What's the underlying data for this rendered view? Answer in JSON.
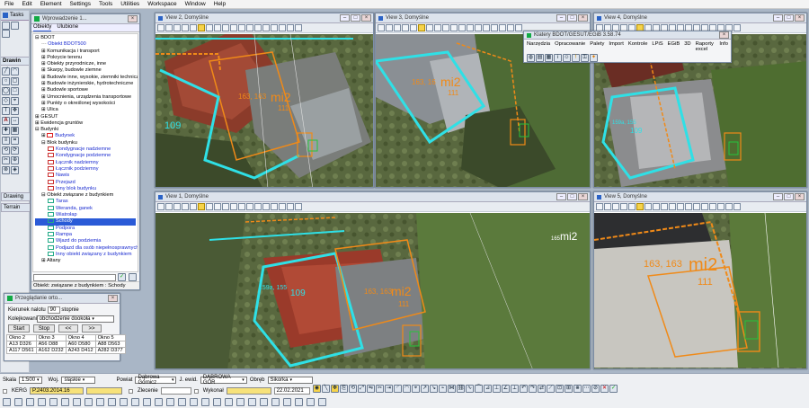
{
  "menu": [
    "File",
    "Edit",
    "Element",
    "Settings",
    "Tools",
    "Utilities",
    "Workspace",
    "Window",
    "Help"
  ],
  "left_panels": {
    "tasks": "Tasks",
    "drawing": "Drawin",
    "drawing2": "Drawing",
    "terrain": "Terrain"
  },
  "objects_window": {
    "title": "Wprowadzenie 1...",
    "tabs": [
      "Obiekty",
      "Ulubione"
    ],
    "tree": [
      {
        "label": "BDOT",
        "level": 0,
        "toggle": "⊟",
        "blue": false
      },
      {
        "label": "Obiekt BDOT500",
        "level": 1,
        "toggle": "",
        "blue": true,
        "dash": true
      },
      {
        "label": "Komunikacja i transport",
        "level": 1,
        "toggle": "⊞"
      },
      {
        "label": "Pokrycie terenu",
        "level": 1,
        "toggle": "⊞"
      },
      {
        "label": "Obiekty przyrodnicze, inne",
        "level": 1,
        "toggle": "⊞"
      },
      {
        "label": "Skarpy, budowle ziemne",
        "level": 1,
        "toggle": "⊞"
      },
      {
        "label": "Budowle inne, wysokie, ziemniki technicz",
        "level": 1,
        "toggle": "⊞"
      },
      {
        "label": "Budowle inżynierskie, hydrotechniczne",
        "level": 1,
        "toggle": "⊞"
      },
      {
        "label": "Budowle sportowe",
        "level": 1,
        "toggle": "⊞"
      },
      {
        "label": "Umocnienia, urządzenia transportowe",
        "level": 1,
        "toggle": "⊞"
      },
      {
        "label": "Punkty o określonej wysokości",
        "level": 1,
        "toggle": "⊞"
      },
      {
        "label": "Ulica",
        "level": 1,
        "toggle": "⊞"
      },
      {
        "label": "GESUT",
        "level": 0,
        "toggle": "⊞"
      },
      {
        "label": "Ewidencja gruntów",
        "level": 0,
        "toggle": "⊞"
      },
      {
        "label": "Budynki",
        "level": 0,
        "toggle": "⊟"
      },
      {
        "label": "Budynek",
        "level": 1,
        "toggle": "⊞",
        "blue": true,
        "swatch": "#d22"
      },
      {
        "label": "Blok budynku",
        "level": 1,
        "toggle": "⊟"
      },
      {
        "label": "Kondygnacje nadziemne",
        "level": 2,
        "blue": true,
        "swatch": "#c33"
      },
      {
        "label": "Kondygnacje podziemne",
        "level": 2,
        "blue": true,
        "swatch": "#c33"
      },
      {
        "label": "Łącznik nadziemny",
        "level": 2,
        "blue": true,
        "swatch": "#c33"
      },
      {
        "label": "Łącznik podziemny",
        "level": 2,
        "blue": true,
        "swatch": "#c33"
      },
      {
        "label": "Nawis",
        "level": 2,
        "blue": true,
        "swatch": "#c33"
      },
      {
        "label": "Przejazd",
        "level": 2,
        "blue": true,
        "swatch": "#c33"
      },
      {
        "label": "Inny blok budynku",
        "level": 2,
        "blue": true,
        "swatch": "#c33"
      },
      {
        "label": "Obiekt związane z budynkiem",
        "level": 1,
        "toggle": "⊟"
      },
      {
        "label": "Taras",
        "level": 2,
        "blue": true,
        "swatch": "#2a8"
      },
      {
        "label": "Weranda, ganek",
        "level": 2,
        "blue": true,
        "swatch": "#2a8"
      },
      {
        "label": "Wiatrołap",
        "level": 2,
        "blue": true,
        "swatch": "#2a8"
      },
      {
        "label": "Schody",
        "level": 2,
        "blue": true,
        "selected": true,
        "swatch": "#2a8"
      },
      {
        "label": "Podpora",
        "level": 2,
        "blue": true,
        "swatch": "#2a8"
      },
      {
        "label": "Rampa",
        "level": 2,
        "blue": true,
        "swatch": "#2a8"
      },
      {
        "label": "Wjazd do podziemia",
        "level": 2,
        "blue": true,
        "swatch": "#2a8"
      },
      {
        "label": "Podjazd dla osób niepełnosprawnych",
        "level": 2,
        "blue": true,
        "swatch": "#2a8"
      },
      {
        "label": "Inny obiekt związany z budynkiem",
        "level": 2,
        "blue": true,
        "swatch": "#2a8"
      },
      {
        "label": "Altany",
        "level": 1,
        "toggle": "⊞"
      }
    ],
    "status": "Obiekt: związane z budynkiem : Schody"
  },
  "browse_window": {
    "title": "Przeglądanie orto...",
    "kierunek_label": "Kierunek nalotu",
    "kierunek_value": "90",
    "kierunek_unit": "stopnie",
    "kolejkowanie_label": "Kolejkowanie",
    "kolejkowanie_value": "obchodzenie dookoła",
    "start": "Start",
    "stop": "Stop",
    "prev": "<<",
    "next": ">>",
    "columns": [
      "Okno 2",
      "Okno 3",
      "Okno 4",
      "Okno 5"
    ],
    "rows": [
      [
        "A13 D326",
        "A56 D88",
        "A60 D580",
        "A88 D563"
      ],
      [
        "A117 D561",
        "A162 D232",
        "A243 D412",
        "A282 D377"
      ]
    ]
  },
  "bdot_toolbar": {
    "title": "Klatery BDOT/GESUT/EGiB 3.58.74",
    "items": [
      "Narzędzia",
      "Opracowanie",
      "Palety",
      "Import",
      "Kontrole",
      "LPiS",
      "EGiB",
      "3D",
      "Raporty excel",
      "Info"
    ]
  },
  "views": [
    {
      "id": "view2",
      "title": "View 2, Domyślne",
      "label_main": "mi2",
      "label_num": "163, 163",
      "label_sub": "111",
      "label_cyan": "109"
    },
    {
      "id": "view3",
      "title": "View 3, Domyślne",
      "label_main": "mi2",
      "label_num": "163, 16",
      "label_sub": "111"
    },
    {
      "id": "view4",
      "title": "View 4, Domyślne",
      "label_main": "mi2",
      "label_num": "165",
      "label_sub": "111",
      "label_cyan": "159a, 155",
      "label_cyan2": "109"
    },
    {
      "id": "view1",
      "title": "View 1, Domyślne",
      "label_main": "mi2",
      "label_num": "163, 163",
      "label_sub": "111",
      "label_cyan": "159a, 155",
      "label_cyan2": "109",
      "label_top": "mi2",
      "label_top_num": "165"
    },
    {
      "id": "view5",
      "title": "View 5, Domyślne",
      "label_main": "mi2",
      "label_num": "163, 163",
      "label_sub": "111"
    }
  ],
  "status_bar": {
    "skala_label": "Skala",
    "skala_value": "1:500",
    "woj_label": "Woj.",
    "woj_value": "śląskie",
    "powiat_label": "Powiat",
    "powiat_value": "Dąbrowa Górnicz",
    "jewid_label": "J. ewid.",
    "jewid_value": "DĄBROWA GÓR",
    "obreb_label": "Obręb",
    "obreb_value": "Sikorka",
    "kerg_label": "KERG",
    "kerg_value": "P.2403.2014.16",
    "zlecenie_label": "Zlecenie",
    "wykonał_label": "Wykonał",
    "date_value": "22.02.2021"
  },
  "colors": {
    "accent": "#2a5ad7",
    "orange": "#f08a18",
    "cyan": "#2fe0e6",
    "green": "#27c33b",
    "red": "#e23c2c"
  }
}
